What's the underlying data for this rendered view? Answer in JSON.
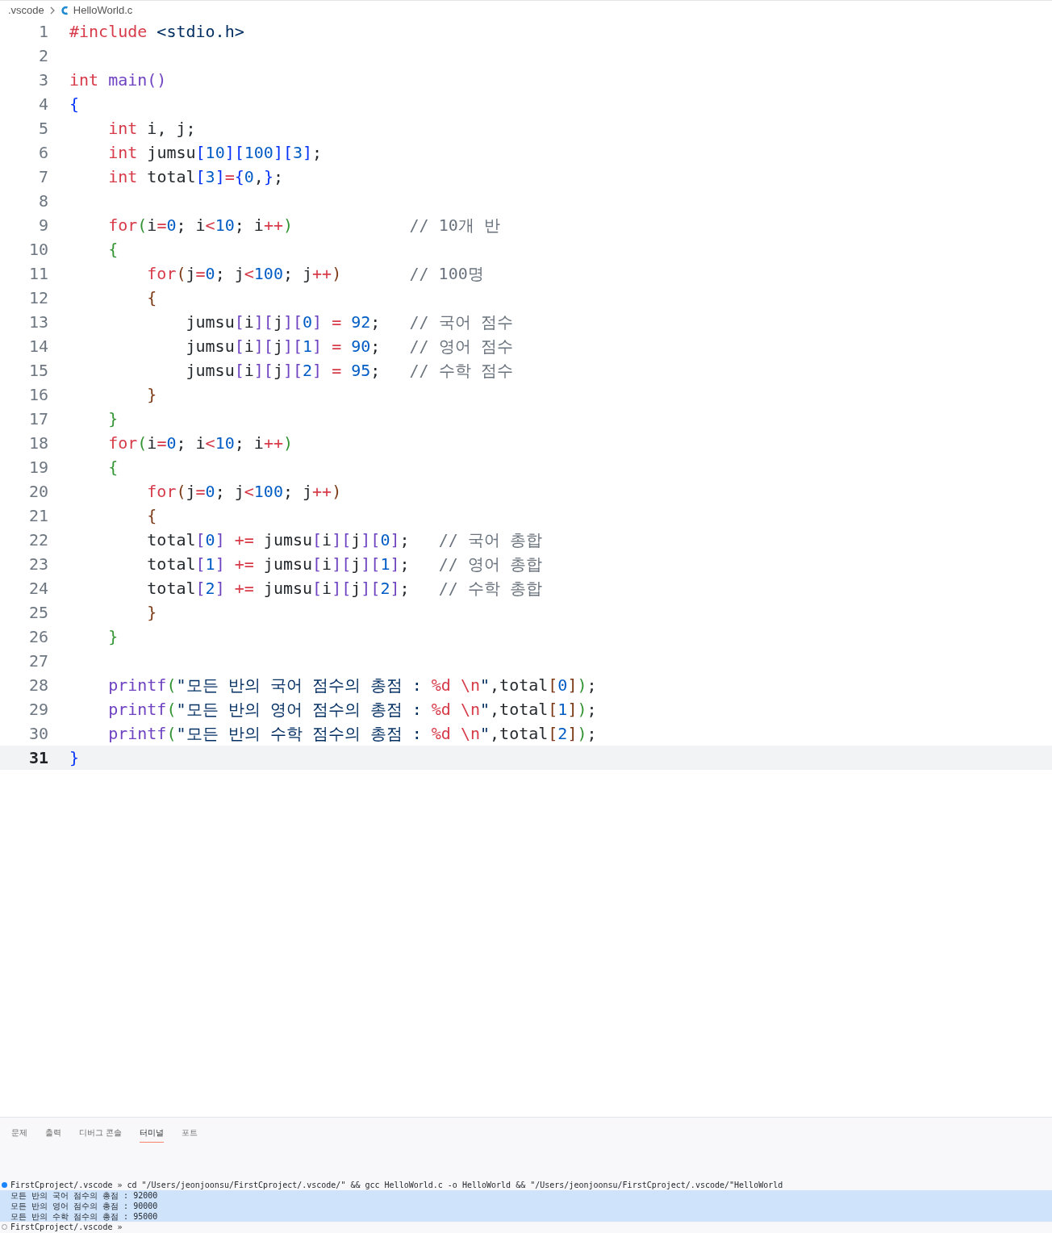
{
  "breadcrumb": {
    "folder": ".vscode",
    "file": "HelloWorld.c"
  },
  "editor": {
    "lines": [
      {
        "number": "1",
        "current": false,
        "tokens": [
          {
            "kind": "kw",
            "text": "#include"
          },
          {
            "kind": "str",
            "text": " <stdio.h>"
          }
        ]
      },
      {
        "number": "2",
        "current": false
      },
      {
        "number": "3",
        "current": false,
        "tokens": [
          {
            "kind": "kw",
            "text": "int"
          },
          {
            "kind": "fn",
            "text": " main()"
          }
        ]
      },
      {
        "number": "4",
        "current": false,
        "tokens": [
          {
            "kind": "b1",
            "text": "{"
          }
        ]
      },
      {
        "number": "5",
        "current": false,
        "tokens": [
          {
            "kind": "kw",
            "text": "    int"
          },
          {
            "kind": "id",
            "text": " i, j;"
          }
        ]
      },
      {
        "number": "6",
        "current": false,
        "tokens": [
          {
            "kind": "kw",
            "text": "    int"
          },
          {
            "kind": "id",
            "text": " jumsu"
          },
          {
            "kind": "b1",
            "text": "["
          },
          {
            "kind": "num",
            "text": "10"
          },
          {
            "kind": "b1",
            "text": "]["
          },
          {
            "kind": "num",
            "text": "100"
          },
          {
            "kind": "b1",
            "text": "]["
          },
          {
            "kind": "num",
            "text": "3"
          },
          {
            "kind": "b1",
            "text": "]"
          },
          {
            "kind": "id",
            "text": ";"
          }
        ]
      },
      {
        "number": "7",
        "current": false,
        "tokens": [
          {
            "kind": "kw",
            "text": "    int"
          },
          {
            "kind": "id",
            "text": " total"
          },
          {
            "kind": "b1",
            "text": "["
          },
          {
            "kind": "num",
            "text": "3"
          },
          {
            "kind": "b1",
            "text": "]"
          },
          {
            "kind": "op",
            "text": "="
          },
          {
            "kind": "b1",
            "text": "{"
          },
          {
            "kind": "num",
            "text": "0"
          },
          {
            "kind": "id",
            "text": ","
          },
          {
            "kind": "b1",
            "text": "}"
          },
          {
            "kind": "id",
            "text": ";"
          }
        ]
      },
      {
        "number": "8",
        "current": false
      },
      {
        "number": "9",
        "current": false,
        "tokens": [
          {
            "kind": "kw",
            "text": "    for"
          },
          {
            "kind": "b2",
            "text": "("
          },
          {
            "kind": "id",
            "text": "i"
          },
          {
            "kind": "op",
            "text": "="
          },
          {
            "kind": "num",
            "text": "0"
          },
          {
            "kind": "id",
            "text": "; i"
          },
          {
            "kind": "op",
            "text": "<"
          },
          {
            "kind": "num",
            "text": "10"
          },
          {
            "kind": "id",
            "text": "; i"
          },
          {
            "kind": "op",
            "text": "++"
          },
          {
            "kind": "b2",
            "text": ")"
          },
          {
            "kind": "cmt",
            "text": "            // 10개 반"
          }
        ]
      },
      {
        "number": "10",
        "current": false,
        "tokens": [
          {
            "kind": "b2",
            "text": "    {"
          }
        ]
      },
      {
        "number": "11",
        "current": false,
        "tokens": [
          {
            "kind": "kw",
            "text": "        for"
          },
          {
            "kind": "b3",
            "text": "("
          },
          {
            "kind": "id",
            "text": "j"
          },
          {
            "kind": "op",
            "text": "="
          },
          {
            "kind": "num",
            "text": "0"
          },
          {
            "kind": "id",
            "text": "; j"
          },
          {
            "kind": "op",
            "text": "<"
          },
          {
            "kind": "num",
            "text": "100"
          },
          {
            "kind": "id",
            "text": "; j"
          },
          {
            "kind": "op",
            "text": "++"
          },
          {
            "kind": "b3",
            "text": ")"
          },
          {
            "kind": "cmt",
            "text": "       // 100명"
          }
        ]
      },
      {
        "number": "12",
        "current": false,
        "tokens": [
          {
            "kind": "b3",
            "text": "        {"
          }
        ]
      },
      {
        "number": "13",
        "current": false,
        "tokens": [
          {
            "kind": "id",
            "text": "            jumsu"
          },
          {
            "kind": "b4",
            "text": "["
          },
          {
            "kind": "id",
            "text": "i"
          },
          {
            "kind": "b4",
            "text": "]["
          },
          {
            "kind": "id",
            "text": "j"
          },
          {
            "kind": "b4",
            "text": "]["
          },
          {
            "kind": "num",
            "text": "0"
          },
          {
            "kind": "b4",
            "text": "]"
          },
          {
            "kind": "op",
            "text": " ="
          },
          {
            "kind": "num",
            "text": " 92"
          },
          {
            "kind": "id",
            "text": ";"
          },
          {
            "kind": "cmt",
            "text": "   // 국어 점수"
          }
        ]
      },
      {
        "number": "14",
        "current": false,
        "tokens": [
          {
            "kind": "id",
            "text": "            jumsu"
          },
          {
            "kind": "b4",
            "text": "["
          },
          {
            "kind": "id",
            "text": "i"
          },
          {
            "kind": "b4",
            "text": "]["
          },
          {
            "kind": "id",
            "text": "j"
          },
          {
            "kind": "b4",
            "text": "]["
          },
          {
            "kind": "num",
            "text": "1"
          },
          {
            "kind": "b4",
            "text": "]"
          },
          {
            "kind": "op",
            "text": " ="
          },
          {
            "kind": "num",
            "text": " 90"
          },
          {
            "kind": "id",
            "text": ";"
          },
          {
            "kind": "cmt",
            "text": "   // 영어 점수"
          }
        ]
      },
      {
        "number": "15",
        "current": false,
        "tokens": [
          {
            "kind": "id",
            "text": "            jumsu"
          },
          {
            "kind": "b4",
            "text": "["
          },
          {
            "kind": "id",
            "text": "i"
          },
          {
            "kind": "b4",
            "text": "]["
          },
          {
            "kind": "id",
            "text": "j"
          },
          {
            "kind": "b4",
            "text": "]["
          },
          {
            "kind": "num",
            "text": "2"
          },
          {
            "kind": "b4",
            "text": "]"
          },
          {
            "kind": "op",
            "text": " ="
          },
          {
            "kind": "num",
            "text": " 95"
          },
          {
            "kind": "id",
            "text": ";"
          },
          {
            "kind": "cmt",
            "text": "   // 수학 점수"
          }
        ]
      },
      {
        "number": "16",
        "current": false,
        "tokens": [
          {
            "kind": "b3",
            "text": "        }"
          }
        ]
      },
      {
        "number": "17",
        "current": false,
        "tokens": [
          {
            "kind": "b2",
            "text": "    }"
          }
        ]
      },
      {
        "number": "18",
        "current": false,
        "tokens": [
          {
            "kind": "kw",
            "text": "    for"
          },
          {
            "kind": "b2",
            "text": "("
          },
          {
            "kind": "id",
            "text": "i"
          },
          {
            "kind": "op",
            "text": "="
          },
          {
            "kind": "num",
            "text": "0"
          },
          {
            "kind": "id",
            "text": "; i"
          },
          {
            "kind": "op",
            "text": "<"
          },
          {
            "kind": "num",
            "text": "10"
          },
          {
            "kind": "id",
            "text": "; i"
          },
          {
            "kind": "op",
            "text": "++"
          },
          {
            "kind": "b2",
            "text": ")"
          }
        ]
      },
      {
        "number": "19",
        "current": false,
        "tokens": [
          {
            "kind": "b2",
            "text": "    {"
          }
        ]
      },
      {
        "number": "20",
        "current": false,
        "tokens": [
          {
            "kind": "kw",
            "text": "        for"
          },
          {
            "kind": "b3",
            "text": "("
          },
          {
            "kind": "id",
            "text": "j"
          },
          {
            "kind": "op",
            "text": "="
          },
          {
            "kind": "num",
            "text": "0"
          },
          {
            "kind": "id",
            "text": "; j"
          },
          {
            "kind": "op",
            "text": "<"
          },
          {
            "kind": "num",
            "text": "100"
          },
          {
            "kind": "id",
            "text": "; j"
          },
          {
            "kind": "op",
            "text": "++"
          },
          {
            "kind": "b3",
            "text": ")"
          }
        ]
      },
      {
        "number": "21",
        "current": false,
        "tokens": [
          {
            "kind": "b3",
            "text": "        {"
          }
        ]
      },
      {
        "number": "22",
        "current": false,
        "tokens": [
          {
            "kind": "id",
            "text": "        total"
          },
          {
            "kind": "b4",
            "text": "["
          },
          {
            "kind": "num",
            "text": "0"
          },
          {
            "kind": "b4",
            "text": "]"
          },
          {
            "kind": "op",
            "text": " +="
          },
          {
            "kind": "id",
            "text": " jumsu"
          },
          {
            "kind": "b4",
            "text": "["
          },
          {
            "kind": "id",
            "text": "i"
          },
          {
            "kind": "b4",
            "text": "]["
          },
          {
            "kind": "id",
            "text": "j"
          },
          {
            "kind": "b4",
            "text": "]["
          },
          {
            "kind": "num",
            "text": "0"
          },
          {
            "kind": "b4",
            "text": "]"
          },
          {
            "kind": "id",
            "text": ";"
          },
          {
            "kind": "cmt",
            "text": "   // 국어 총합"
          }
        ]
      },
      {
        "number": "23",
        "current": false,
        "tokens": [
          {
            "kind": "id",
            "text": "        total"
          },
          {
            "kind": "b4",
            "text": "["
          },
          {
            "kind": "num",
            "text": "1"
          },
          {
            "kind": "b4",
            "text": "]"
          },
          {
            "kind": "op",
            "text": " +="
          },
          {
            "kind": "id",
            "text": " jumsu"
          },
          {
            "kind": "b4",
            "text": "["
          },
          {
            "kind": "id",
            "text": "i"
          },
          {
            "kind": "b4",
            "text": "]["
          },
          {
            "kind": "id",
            "text": "j"
          },
          {
            "kind": "b4",
            "text": "]["
          },
          {
            "kind": "num",
            "text": "1"
          },
          {
            "kind": "b4",
            "text": "]"
          },
          {
            "kind": "id",
            "text": ";"
          },
          {
            "kind": "cmt",
            "text": "   // 영어 총합"
          }
        ]
      },
      {
        "number": "24",
        "current": false,
        "tokens": [
          {
            "kind": "id",
            "text": "        total"
          },
          {
            "kind": "b4",
            "text": "["
          },
          {
            "kind": "num",
            "text": "2"
          },
          {
            "kind": "b4",
            "text": "]"
          },
          {
            "kind": "op",
            "text": " +="
          },
          {
            "kind": "id",
            "text": " jumsu"
          },
          {
            "kind": "b4",
            "text": "["
          },
          {
            "kind": "id",
            "text": "i"
          },
          {
            "kind": "b4",
            "text": "]["
          },
          {
            "kind": "id",
            "text": "j"
          },
          {
            "kind": "b4",
            "text": "]["
          },
          {
            "kind": "num",
            "text": "2"
          },
          {
            "kind": "b4",
            "text": "]"
          },
          {
            "kind": "id",
            "text": ";"
          },
          {
            "kind": "cmt",
            "text": "   // 수학 총합"
          }
        ]
      },
      {
        "number": "25",
        "current": false,
        "tokens": [
          {
            "kind": "b3",
            "text": "        }"
          }
        ]
      },
      {
        "number": "26",
        "current": false,
        "tokens": [
          {
            "kind": "b2",
            "text": "    }"
          }
        ]
      },
      {
        "number": "27",
        "current": false
      },
      {
        "number": "28",
        "current": false,
        "tokens": [
          {
            "kind": "fn",
            "text": "    printf"
          },
          {
            "kind": "b2",
            "text": "("
          },
          {
            "kind": "str",
            "text": "\"모든 반의 국어 점수의 총점 : "
          },
          {
            "kind": "esc",
            "text": "%d \\n"
          },
          {
            "kind": "str",
            "text": "\""
          },
          {
            "kind": "id",
            "text": ",total"
          },
          {
            "kind": "b3",
            "text": "["
          },
          {
            "kind": "num",
            "text": "0"
          },
          {
            "kind": "b3",
            "text": "]"
          },
          {
            "kind": "b2",
            "text": ")"
          },
          {
            "kind": "id",
            "text": ";"
          }
        ]
      },
      {
        "number": "29",
        "current": false,
        "tokens": [
          {
            "kind": "fn",
            "text": "    printf"
          },
          {
            "kind": "b2",
            "text": "("
          },
          {
            "kind": "str",
            "text": "\"모든 반의 영어 점수의 총점 : "
          },
          {
            "kind": "esc",
            "text": "%d \\n"
          },
          {
            "kind": "str",
            "text": "\""
          },
          {
            "kind": "id",
            "text": ",total"
          },
          {
            "kind": "b3",
            "text": "["
          },
          {
            "kind": "num",
            "text": "1"
          },
          {
            "kind": "b3",
            "text": "]"
          },
          {
            "kind": "b2",
            "text": ")"
          },
          {
            "kind": "id",
            "text": ";"
          }
        ]
      },
      {
        "number": "30",
        "current": false,
        "tokens": [
          {
            "kind": "fn",
            "text": "    printf"
          },
          {
            "kind": "b2",
            "text": "("
          },
          {
            "kind": "str",
            "text": "\"모든 반의 수학 점수의 총점 : "
          },
          {
            "kind": "esc",
            "text": "%d \\n"
          },
          {
            "kind": "str",
            "text": "\""
          },
          {
            "kind": "id",
            "text": ",total"
          },
          {
            "kind": "b3",
            "text": "["
          },
          {
            "kind": "num",
            "text": "2"
          },
          {
            "kind": "b3",
            "text": "]"
          },
          {
            "kind": "b2",
            "text": ")"
          },
          {
            "kind": "id",
            "text": ";"
          }
        ]
      },
      {
        "number": "31",
        "current": true,
        "tokens": [
          {
            "kind": "b1",
            "text": "}"
          }
        ]
      }
    ]
  },
  "panel": {
    "tabs": [
      {
        "label": "문제",
        "selected": false
      },
      {
        "label": "출력",
        "selected": false
      },
      {
        "label": "디버그 콘솔",
        "selected": false
      },
      {
        "label": "터미널",
        "selected": true
      },
      {
        "label": "포트",
        "selected": false
      }
    ],
    "terminal": [
      {
        "kind": "prompt",
        "text": "FirstCproject/.vscode » cd \"/Users/jeonjoonsu/FirstCproject/.vscode/\" && gcc HelloWorld.c -o HelloWorld && \"/Users/jeonjoonsu/FirstCproject/.vscode/\"HelloWorld",
        "selected": false
      },
      {
        "kind": "output",
        "text": "모든 반의 국어 점수의 총점 : 92000",
        "selected": true
      },
      {
        "kind": "output",
        "text": "모든 반의 영어 점수의 총점 : 90000",
        "selected": true
      },
      {
        "kind": "output",
        "text": "모든 반의 수학 점수의 총점 : 95000",
        "selected": true
      },
      {
        "kind": "idle",
        "text": "FirstCproject/.vscode »",
        "selected": false
      }
    ]
  }
}
